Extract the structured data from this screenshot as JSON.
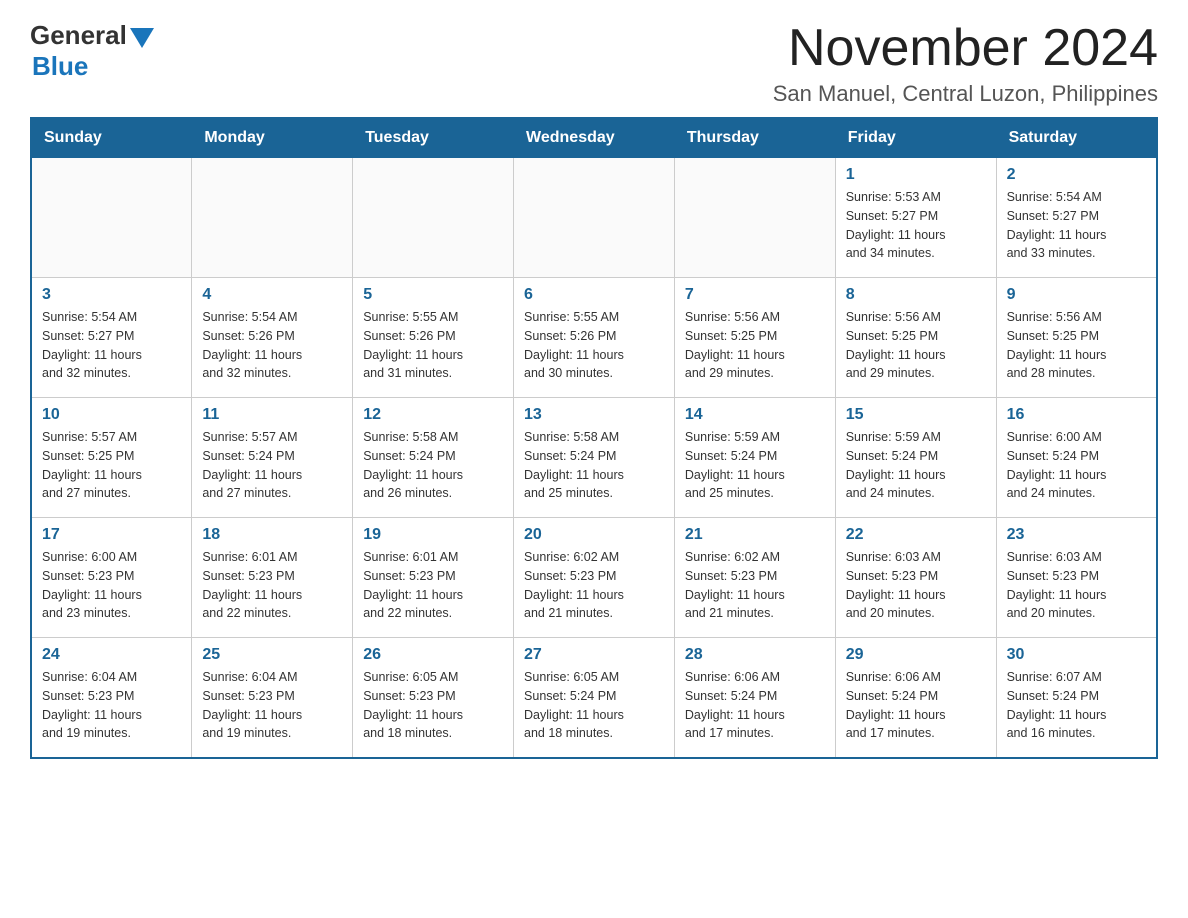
{
  "header": {
    "logo_general": "General",
    "logo_blue": "Blue",
    "title": "November 2024",
    "subtitle": "San Manuel, Central Luzon, Philippines"
  },
  "days_of_week": [
    "Sunday",
    "Monday",
    "Tuesday",
    "Wednesday",
    "Thursday",
    "Friday",
    "Saturday"
  ],
  "weeks": [
    [
      {
        "day": "",
        "info": ""
      },
      {
        "day": "",
        "info": ""
      },
      {
        "day": "",
        "info": ""
      },
      {
        "day": "",
        "info": ""
      },
      {
        "day": "",
        "info": ""
      },
      {
        "day": "1",
        "info": "Sunrise: 5:53 AM\nSunset: 5:27 PM\nDaylight: 11 hours\nand 34 minutes."
      },
      {
        "day": "2",
        "info": "Sunrise: 5:54 AM\nSunset: 5:27 PM\nDaylight: 11 hours\nand 33 minutes."
      }
    ],
    [
      {
        "day": "3",
        "info": "Sunrise: 5:54 AM\nSunset: 5:27 PM\nDaylight: 11 hours\nand 32 minutes."
      },
      {
        "day": "4",
        "info": "Sunrise: 5:54 AM\nSunset: 5:26 PM\nDaylight: 11 hours\nand 32 minutes."
      },
      {
        "day": "5",
        "info": "Sunrise: 5:55 AM\nSunset: 5:26 PM\nDaylight: 11 hours\nand 31 minutes."
      },
      {
        "day": "6",
        "info": "Sunrise: 5:55 AM\nSunset: 5:26 PM\nDaylight: 11 hours\nand 30 minutes."
      },
      {
        "day": "7",
        "info": "Sunrise: 5:56 AM\nSunset: 5:25 PM\nDaylight: 11 hours\nand 29 minutes."
      },
      {
        "day": "8",
        "info": "Sunrise: 5:56 AM\nSunset: 5:25 PM\nDaylight: 11 hours\nand 29 minutes."
      },
      {
        "day": "9",
        "info": "Sunrise: 5:56 AM\nSunset: 5:25 PM\nDaylight: 11 hours\nand 28 minutes."
      }
    ],
    [
      {
        "day": "10",
        "info": "Sunrise: 5:57 AM\nSunset: 5:25 PM\nDaylight: 11 hours\nand 27 minutes."
      },
      {
        "day": "11",
        "info": "Sunrise: 5:57 AM\nSunset: 5:24 PM\nDaylight: 11 hours\nand 27 minutes."
      },
      {
        "day": "12",
        "info": "Sunrise: 5:58 AM\nSunset: 5:24 PM\nDaylight: 11 hours\nand 26 minutes."
      },
      {
        "day": "13",
        "info": "Sunrise: 5:58 AM\nSunset: 5:24 PM\nDaylight: 11 hours\nand 25 minutes."
      },
      {
        "day": "14",
        "info": "Sunrise: 5:59 AM\nSunset: 5:24 PM\nDaylight: 11 hours\nand 25 minutes."
      },
      {
        "day": "15",
        "info": "Sunrise: 5:59 AM\nSunset: 5:24 PM\nDaylight: 11 hours\nand 24 minutes."
      },
      {
        "day": "16",
        "info": "Sunrise: 6:00 AM\nSunset: 5:24 PM\nDaylight: 11 hours\nand 24 minutes."
      }
    ],
    [
      {
        "day": "17",
        "info": "Sunrise: 6:00 AM\nSunset: 5:23 PM\nDaylight: 11 hours\nand 23 minutes."
      },
      {
        "day": "18",
        "info": "Sunrise: 6:01 AM\nSunset: 5:23 PM\nDaylight: 11 hours\nand 22 minutes."
      },
      {
        "day": "19",
        "info": "Sunrise: 6:01 AM\nSunset: 5:23 PM\nDaylight: 11 hours\nand 22 minutes."
      },
      {
        "day": "20",
        "info": "Sunrise: 6:02 AM\nSunset: 5:23 PM\nDaylight: 11 hours\nand 21 minutes."
      },
      {
        "day": "21",
        "info": "Sunrise: 6:02 AM\nSunset: 5:23 PM\nDaylight: 11 hours\nand 21 minutes."
      },
      {
        "day": "22",
        "info": "Sunrise: 6:03 AM\nSunset: 5:23 PM\nDaylight: 11 hours\nand 20 minutes."
      },
      {
        "day": "23",
        "info": "Sunrise: 6:03 AM\nSunset: 5:23 PM\nDaylight: 11 hours\nand 20 minutes."
      }
    ],
    [
      {
        "day": "24",
        "info": "Sunrise: 6:04 AM\nSunset: 5:23 PM\nDaylight: 11 hours\nand 19 minutes."
      },
      {
        "day": "25",
        "info": "Sunrise: 6:04 AM\nSunset: 5:23 PM\nDaylight: 11 hours\nand 19 minutes."
      },
      {
        "day": "26",
        "info": "Sunrise: 6:05 AM\nSunset: 5:23 PM\nDaylight: 11 hours\nand 18 minutes."
      },
      {
        "day": "27",
        "info": "Sunrise: 6:05 AM\nSunset: 5:24 PM\nDaylight: 11 hours\nand 18 minutes."
      },
      {
        "day": "28",
        "info": "Sunrise: 6:06 AM\nSunset: 5:24 PM\nDaylight: 11 hours\nand 17 minutes."
      },
      {
        "day": "29",
        "info": "Sunrise: 6:06 AM\nSunset: 5:24 PM\nDaylight: 11 hours\nand 17 minutes."
      },
      {
        "day": "30",
        "info": "Sunrise: 6:07 AM\nSunset: 5:24 PM\nDaylight: 11 hours\nand 16 minutes."
      }
    ]
  ]
}
